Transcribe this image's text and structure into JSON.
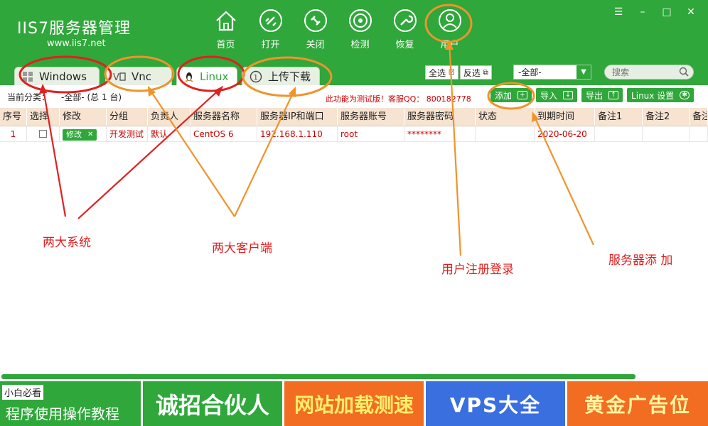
{
  "app": {
    "logo_text": "IIS7服务器管理",
    "logo_url": "www.iis7.net"
  },
  "toolbar": [
    {
      "label": "首页",
      "icon": "home-icon"
    },
    {
      "label": "打开",
      "icon": "link-icon"
    },
    {
      "label": "关闭",
      "icon": "unlink-icon"
    },
    {
      "label": "检测",
      "icon": "radar-icon"
    },
    {
      "label": "恢复",
      "icon": "wrench-icon"
    },
    {
      "label": "用户",
      "icon": "user-icon"
    }
  ],
  "window_controls": {
    "menu": "☰",
    "minimize": "–",
    "maximize": "□",
    "close": "✕"
  },
  "tabs": [
    {
      "label": "Windows",
      "icon": "windows-icon"
    },
    {
      "label": "Vnc",
      "icon": "vnc-icon"
    },
    {
      "label": "Linux",
      "icon": "linux-icon"
    },
    {
      "label": "上传下载",
      "icon": "upload-download-icon"
    }
  ],
  "selection": {
    "select_all": "全选",
    "invert": "反选"
  },
  "filter": {
    "selected": "-全部-"
  },
  "search": {
    "placeholder": "搜索"
  },
  "info": {
    "current_category_label": "当前分类：",
    "current_category_value": "-全部- (总 1 台)",
    "notice": "此功能为测试版！客服QQ： 800182778"
  },
  "actions": [
    {
      "label": "添加",
      "icon": "add-icon"
    },
    {
      "label": "导入",
      "icon": "import-icon"
    },
    {
      "label": "导出",
      "icon": "export-icon"
    },
    {
      "label": "Linux 设置",
      "icon": "gear-icon"
    }
  ],
  "table": {
    "columns": [
      "序号",
      "选择",
      "修改",
      "分组",
      "负责人",
      "服务器名称",
      "服务器IP和端口",
      "服务器账号",
      "服务器密码",
      "状态",
      "到期时间",
      "备注1",
      "备注2",
      "备注"
    ],
    "rows": [
      {
        "index": "1",
        "edit": "修改",
        "group": "开发测试",
        "owner": "默认",
        "name": "CentOS 6",
        "ip": "192.168.1.110",
        "account": "root",
        "password": "********",
        "status": "",
        "expire": "2020-06-20",
        "note1": "",
        "note2": ""
      }
    ]
  },
  "banners": {
    "b1_tag": "小白必看",
    "b1_main": "程序使用操作教程",
    "b2": "诚招合伙人",
    "b3": "网站加载测速",
    "b4": "VPS大全",
    "b5": "黄金广告位"
  },
  "annotations": {
    "two_systems": "两大系统",
    "two_clients": "两大客户端",
    "user_login": "用户注册登录",
    "server_add": "服务器添 加"
  },
  "colors": {
    "brand_green": "#2fa73a",
    "header_row": "#f6e3d0",
    "row_text": "#cc0000",
    "annotation_red": "#e02020",
    "annotation_orange": "#f0932b"
  }
}
